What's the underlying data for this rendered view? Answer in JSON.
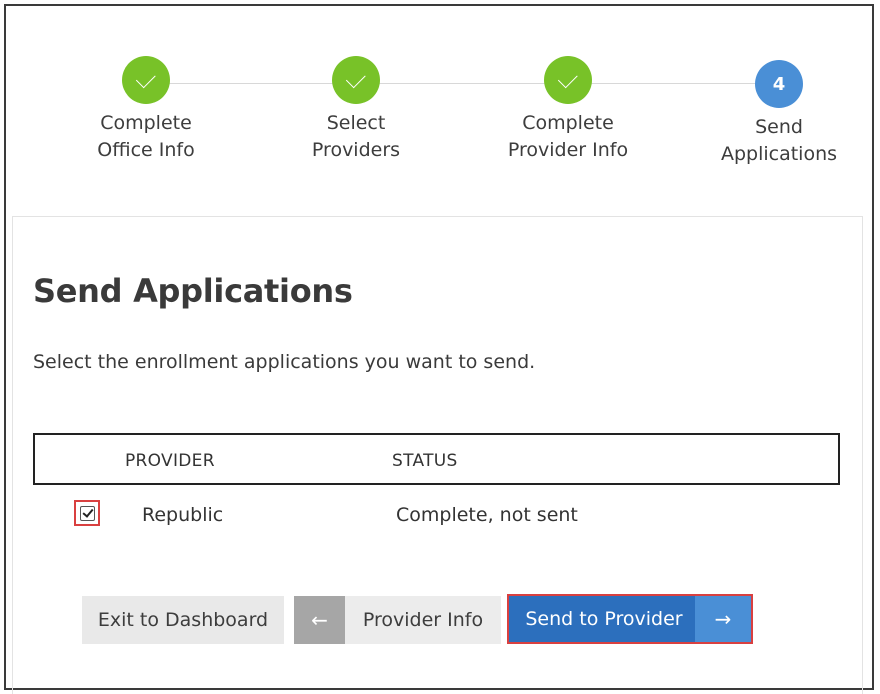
{
  "stepper": {
    "steps": [
      {
        "label_line1": "Complete",
        "label_line2": "Office Info",
        "state": "done"
      },
      {
        "label_line1": "Select",
        "label_line2": "Providers",
        "state": "done"
      },
      {
        "label_line1": "Complete",
        "label_line2": "Provider Info",
        "state": "done"
      },
      {
        "number": "4",
        "label_line1": "Send",
        "label_line2": "Applications",
        "state": "current"
      }
    ]
  },
  "main": {
    "title": "Send Applications",
    "subtitle": "Select the enrollment applications you want to send.",
    "table": {
      "columns": [
        "PROVIDER",
        "STATUS"
      ],
      "rows": [
        {
          "checked": true,
          "provider": "Republic",
          "status": "Complete, not sent"
        }
      ]
    }
  },
  "actions": {
    "exit_label": "Exit to Dashboard",
    "back_arrow": "←",
    "back_label": "Provider Info",
    "send_label": "Send to Provider",
    "send_arrow": "→"
  },
  "colors": {
    "done": "#78c228",
    "current": "#4a8fd6",
    "primary": "#2c6fbd",
    "highlight_border": "#d94040"
  }
}
